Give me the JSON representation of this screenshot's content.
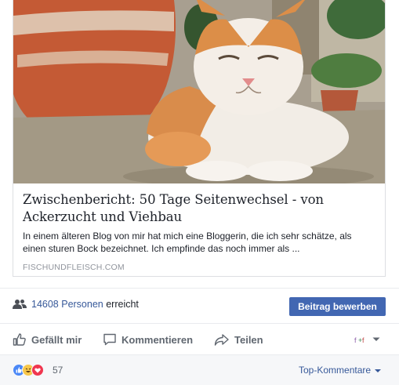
{
  "card": {
    "image_alt": "cat-photo",
    "title_line1": "Zwischenbericht: 50 Tage Seitenwechsel - von",
    "title_line2": "Ackerzucht und Viehbau",
    "description_line1": "In einem älteren Blog von mir hat mich eine Bloggerin, die ich sehr schätze, als",
    "description_line2": "einen sturen Bock bezeichnet. Ich empfinde das noch immer als ...",
    "domain": "FISCHUNDFLEISCH.COM"
  },
  "reach": {
    "icon": "people-icon",
    "count_text": "14608 Personen",
    "suffix": " erreicht",
    "boost_label": "Beitrag bewerben"
  },
  "actions": {
    "like_label": "Gefällt mir",
    "comment_label": "Kommentieren",
    "share_label": "Teilen"
  },
  "footer": {
    "reactions": [
      "like",
      "haha",
      "love"
    ],
    "reaction_count": "57",
    "sort_label": "Top-Kommentare"
  },
  "colors": {
    "accent": "#4267b2",
    "link": "#365899",
    "muted": "#606770",
    "like": "#4b88f7",
    "haha": "#f7c74b",
    "love": "#f0364f"
  }
}
